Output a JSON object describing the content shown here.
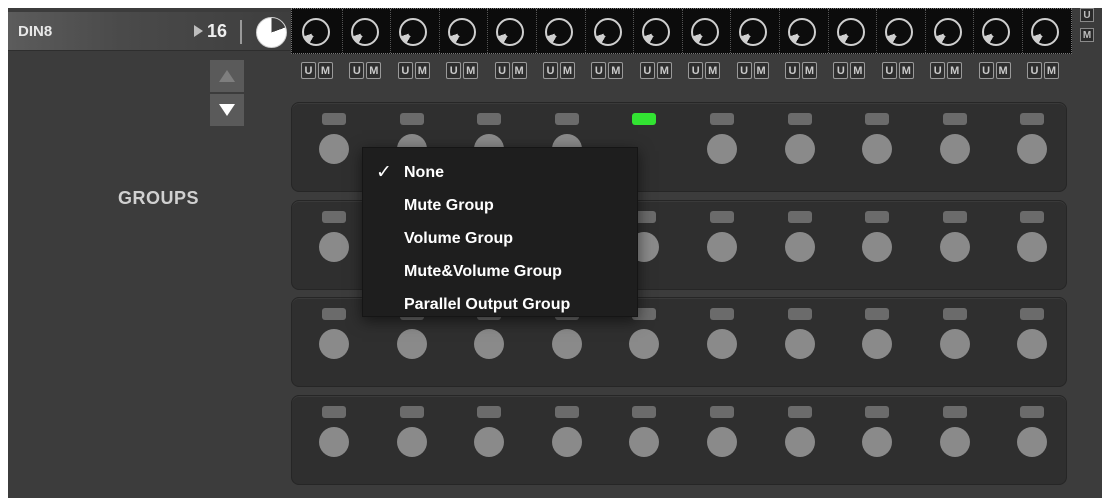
{
  "header": {
    "device_name": "DIN8",
    "channel_count": "16",
    "play_icon": "play-icon",
    "master_knob_icon": "knob-icon"
  },
  "knob_strip": {
    "count": 16,
    "icon": "knob-icon"
  },
  "side_buttons": {
    "u_label": "U",
    "m_label": "M"
  },
  "um_row": {
    "count": 16,
    "u_label": "U",
    "m_label": "M"
  },
  "scroll": {
    "up_icon": "triangle-up-icon",
    "down_icon": "triangle-down-icon"
  },
  "groups_label": "GROUPS",
  "group_panels": {
    "rows": 4,
    "slots_per_row": 10,
    "active_led": {
      "row": 0,
      "slot": 4
    }
  },
  "colors": {
    "active_led": "#32e332",
    "panel": "#2f2f2f",
    "background": "#3c3c3c",
    "menu": "#1e1e1e"
  },
  "menu": {
    "items": [
      {
        "label": "None",
        "checked": true
      },
      {
        "label": "Mute Group",
        "checked": false
      },
      {
        "label": "Volume Group",
        "checked": false
      },
      {
        "label": "Mute&Volume Group",
        "checked": false
      },
      {
        "label": "Parallel Output Group",
        "checked": false
      }
    ],
    "check_glyph": "✓"
  }
}
